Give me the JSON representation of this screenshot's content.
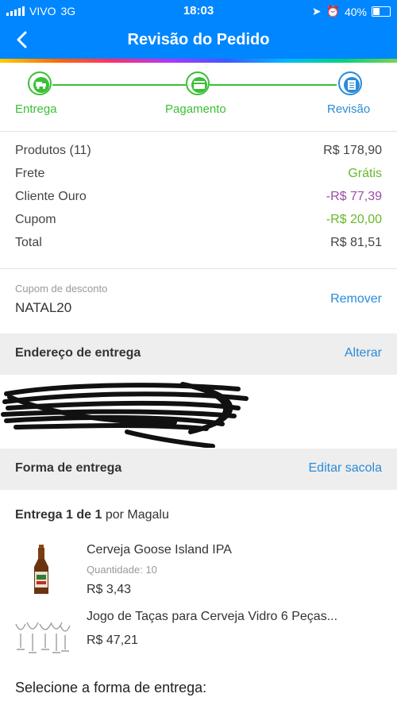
{
  "status_bar": {
    "carrier": "VIVO",
    "network": "3G",
    "time": "18:03",
    "battery": "40%"
  },
  "header": {
    "title": "Revisão do Pedido",
    "back_icon": "chevron-left-icon"
  },
  "stepper": {
    "steps": [
      {
        "label": "Entrega",
        "icon": "truck-icon",
        "color": "#3bbf35"
      },
      {
        "label": "Pagamento",
        "icon": "card-icon",
        "color": "#3bbf35"
      },
      {
        "label": "Revisão",
        "icon": "document-icon",
        "color": "#2a8bd8"
      }
    ]
  },
  "summary": {
    "rows": [
      {
        "label": "Produtos (11)",
        "value": "R$ 178,90",
        "color": "#444444"
      },
      {
        "label": "Frete",
        "value": "Grátis",
        "color": "#6ab72c"
      },
      {
        "label": "Cliente Ouro",
        "value": "-R$ 77,39",
        "color": "#9b4ea5"
      },
      {
        "label": "Cupom",
        "value": "-R$ 20,00",
        "color": "#6ab72c"
      },
      {
        "label": "Total",
        "value": "R$ 81,51",
        "color": "#444444"
      }
    ]
  },
  "coupon": {
    "label": "Cupom de desconto",
    "code": "NATAL20",
    "action": "Remover"
  },
  "address_section": {
    "title": "Endereço de entrega",
    "action": "Alterar"
  },
  "delivery_section": {
    "title": "Forma de entrega",
    "action": "Editar sacola"
  },
  "delivery": {
    "count_prefix": "Entrega 1 de 1",
    "count_suffix": " por Magalu",
    "products": [
      {
        "name": "Cerveja Goose Island IPA",
        "quantity": "Quantidade: 10",
        "price": "R$ 3,43"
      },
      {
        "name": "Jogo de Taças para Cerveja Vidro 6 Peças...",
        "price": "R$ 47,21"
      }
    ],
    "select_title": "Selecione a forma de entrega:"
  },
  "colors": {
    "brand_blue": "#0086ff",
    "link_blue": "#2a8bd8",
    "green": "#3bbf35"
  }
}
